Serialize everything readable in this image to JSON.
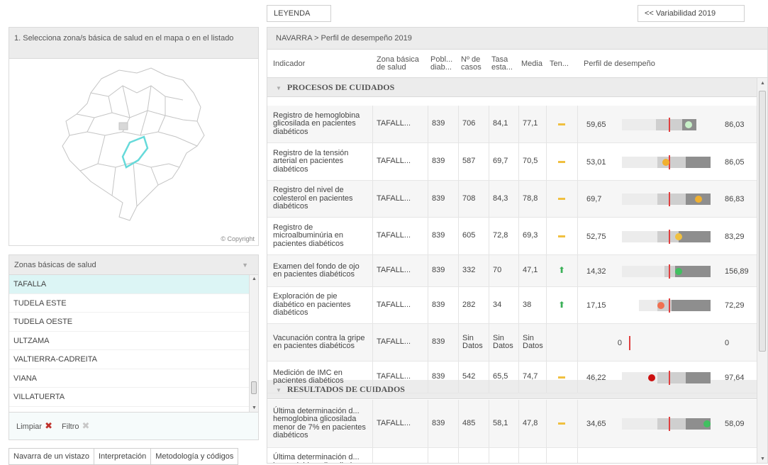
{
  "top": {
    "legend_btn": "LEYENDA",
    "variability_btn": "<< Variabilidad 2019"
  },
  "map_panel": {
    "title": "1. Selecciona zona/s básica de salud en el mapa o en el listado",
    "copyright": "© Copyright"
  },
  "zones": {
    "header": "Zonas básicas de salud",
    "items": [
      "TAFALLA",
      "TUDELA ESTE",
      "TUDELA OESTE",
      "ULTZAMA",
      "VALTIERRA-CADREITA",
      "VIANA",
      "VILLATUERTA"
    ],
    "selected": "TAFALLA",
    "clear_label": "Limpiar",
    "filter_label": "Filtro"
  },
  "tabs": [
    "Navarra de un vistazo",
    "Interpretación",
    "Metodología y códigos"
  ],
  "main": {
    "breadcrumb": "NAVARRA > Perfil de desempeño 2019",
    "columns": {
      "indicator": "Indicador",
      "zone": "Zona básica de salud",
      "pop": "Pobl... diab...",
      "cases": "Nº de casos",
      "rate": "Tasa esta...",
      "mean": "Media",
      "trend": "Ten...",
      "profile": "Perfil de desempeño"
    },
    "sections": [
      {
        "title": "PROCESOS DE CUIDADOS"
      },
      {
        "title": "RESULTADOS DE CUIDADOS"
      }
    ],
    "rows": [
      {
        "indicator": "Registro de hemoglobina glicosilada en pacientes diabéticos",
        "zone": "TAFALL...",
        "pop": "839",
        "cases": "706",
        "rate": "84,1",
        "mean": "77,1",
        "trend": "equal",
        "min": "59,65",
        "max": "86,03",
        "dot_color": "#c8f0c8"
      },
      {
        "indicator": "Registro de la tensión arterial en pacientes diabéticos",
        "zone": "TAFALL...",
        "pop": "839",
        "cases": "587",
        "rate": "69,7",
        "mean": "70,5",
        "trend": "equal",
        "min": "53,01",
        "max": "86,05",
        "dot_color": "#f0b030"
      },
      {
        "indicator": "Registro del nivel de colesterol en pacientes diabéticos",
        "zone": "TAFALL...",
        "pop": "839",
        "cases": "708",
        "rate": "84,3",
        "mean": "78,8",
        "trend": "equal",
        "min": "69,7",
        "max": "86,83",
        "dot_color": "#f0b030"
      },
      {
        "indicator": "Registro de microalbuminúria en pacientes diabéticos",
        "zone": "TAFALL...",
        "pop": "839",
        "cases": "605",
        "rate": "72,8",
        "mean": "69,3",
        "trend": "equal",
        "min": "52,75",
        "max": "83,29",
        "dot_color": "#f0c040"
      },
      {
        "indicator": "Examen del fondo de ojo en pacientes diabéticos",
        "zone": "TAFALL...",
        "pop": "839",
        "cases": "332",
        "rate": "70",
        "mean": "47,1",
        "trend": "up",
        "min": "14,32",
        "max": "156,89",
        "dot_color": "#40c060"
      },
      {
        "indicator": "Exploración de pie diabético en pacientes diabéticos",
        "zone": "TAFALL...",
        "pop": "839",
        "cases": "282",
        "rate": "34",
        "mean": "38",
        "trend": "up",
        "min": "17,15",
        "max": "72,29",
        "dot_color": "#f07050"
      },
      {
        "indicator": "Vacunación contra la gripe en pacientes diabéticos",
        "zone": "TAFALL...",
        "pop": "839",
        "cases": "Sin Datos",
        "rate": "Sin Datos",
        "mean": "Sin Datos",
        "trend": "none",
        "min": "0",
        "max": "0",
        "dot_color": ""
      },
      {
        "indicator": "Medición de IMC en pacientes diabéticos",
        "zone": "TAFALL...",
        "pop": "839",
        "cases": "542",
        "rate": "65,5",
        "mean": "74,7",
        "trend": "equal",
        "min": "46,22",
        "max": "97,64",
        "dot_color": "#cc1010"
      },
      {
        "indicator": "Última determinación d... hemoglobina glicosilada menor de 7% en pacientes diabéticos",
        "zone": "TAFALL...",
        "pop": "839",
        "cases": "485",
        "rate": "58,1",
        "mean": "47,8",
        "trend": "equal",
        "min": "34,65",
        "max": "58,09",
        "dot_color": "#40c060"
      },
      {
        "indicator": "Última determinación d... hemoglobina glicosilada",
        "zone": "",
        "pop": "",
        "cases": "",
        "rate": "",
        "mean": "",
        "trend": "none",
        "min": "",
        "max": "",
        "dot_color": ""
      }
    ]
  },
  "colors": {
    "accent_line": "#e04040",
    "selected_zone_bg": "#dcf5f5",
    "trend_equal": "#f0c040",
    "trend_up": "#3bb058"
  }
}
